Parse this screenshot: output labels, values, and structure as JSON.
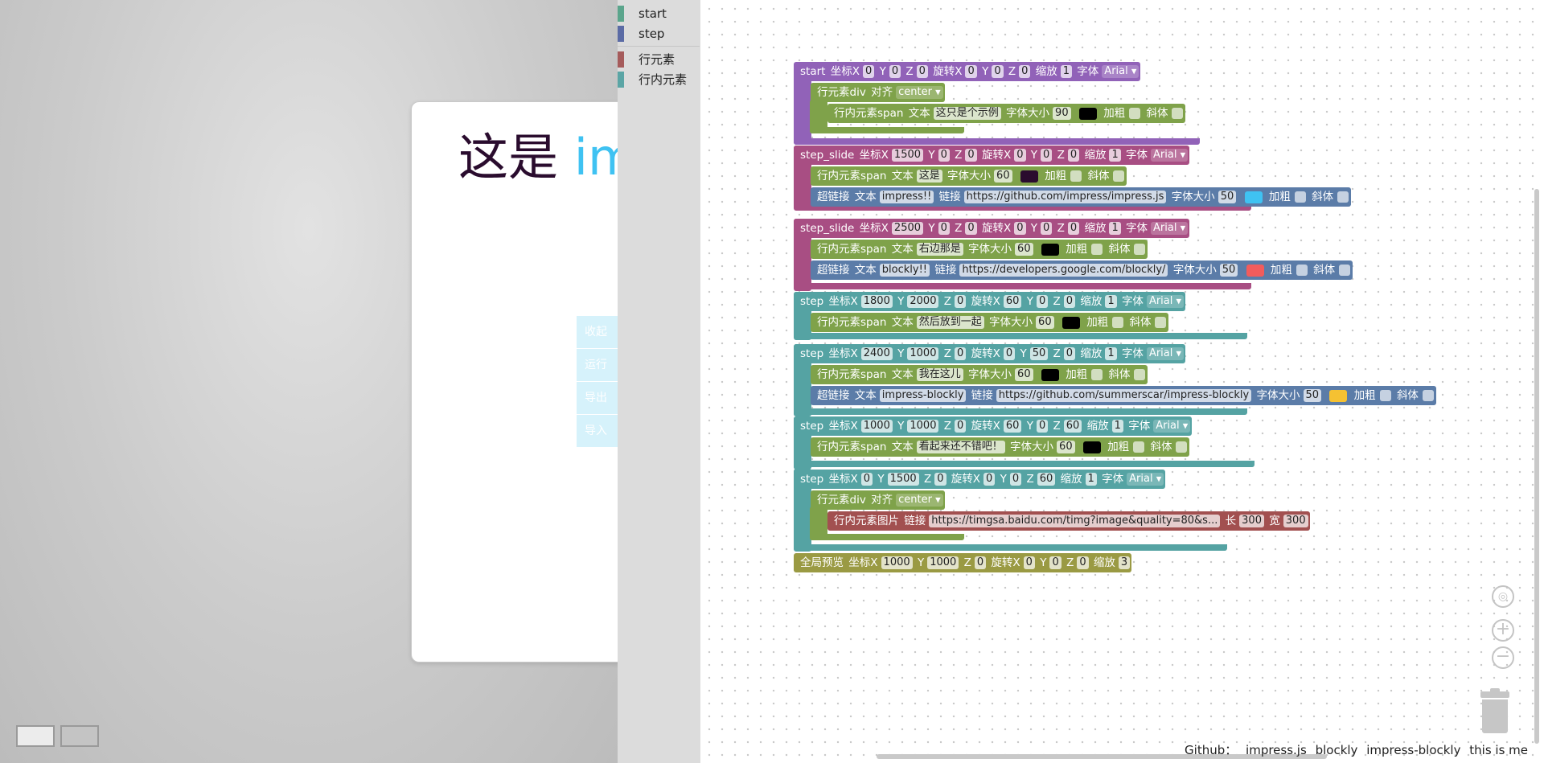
{
  "slide": {
    "text_dark": "这是",
    "text_blue": "imp"
  },
  "menu": [
    "收起",
    "运行",
    "导出",
    "导入"
  ],
  "toolbox": {
    "categories": [
      {
        "label": "start",
        "color": "#5ba58c"
      },
      {
        "label": "step",
        "color": "#5b6ba5"
      },
      {
        "label": "行元素",
        "color": "#a55b5b"
      },
      {
        "label": "行内元素",
        "color": "#5ba5a5"
      }
    ]
  },
  "blocks": {
    "b1": {
      "label": "start",
      "kx": "坐标X",
      "x": "0",
      "ky": "Y",
      "y": "0",
      "kz": "Z",
      "z": "0",
      "krx": "旋转X",
      "rx": "0",
      "kry": "Y",
      "ry": "0",
      "krz": "Z",
      "rz": "0",
      "ks": "缩放",
      "s": "1",
      "kf": "字体",
      "font": "Arial"
    },
    "b1d": {
      "label": "行元素div",
      "ka": "对齐",
      "align": "center"
    },
    "b1s": {
      "label": "行内元素span",
      "kt": "文本",
      "text": "这只是个示例",
      "kfs": "字体大小",
      "fs": "90",
      "kb": "加粗",
      "ki": "斜体",
      "color": "#000000"
    },
    "b2": {
      "label": "step_slide",
      "kx": "坐标X",
      "x": "1500",
      "ky": "Y",
      "y": "0",
      "kz": "Z",
      "z": "0",
      "krx": "旋转X",
      "rx": "0",
      "kry": "Y",
      "ry": "0",
      "krz": "Z",
      "rz": "0",
      "ks": "缩放",
      "s": "1",
      "kf": "字体",
      "font": "Arial"
    },
    "b2s": {
      "label": "行内元素span",
      "kt": "文本",
      "text": "这是",
      "kfs": "字体大小",
      "fs": "60",
      "kb": "加粗",
      "ki": "斜体",
      "color": "#2a0c2e"
    },
    "b2l": {
      "label": "超链接",
      "kt": "文本",
      "text": "impress!!",
      "kl": "链接",
      "link": "https://github.com/impress/impress.js",
      "kfs": "字体大小",
      "fs": "50",
      "kb": "加粗",
      "ki": "斜体",
      "color": "#3fc2f2"
    },
    "b3": {
      "label": "step_slide",
      "kx": "坐标X",
      "x": "2500",
      "ky": "Y",
      "y": "0",
      "kz": "Z",
      "z": "0",
      "krx": "旋转X",
      "rx": "0",
      "kry": "Y",
      "ry": "0",
      "krz": "Z",
      "rz": "0",
      "ks": "缩放",
      "s": "1",
      "kf": "字体",
      "font": "Arial"
    },
    "b3s": {
      "label": "行内元素span",
      "kt": "文本",
      "text": "右边那是",
      "kfs": "字体大小",
      "fs": "60",
      "kb": "加粗",
      "ki": "斜体",
      "color": "#000000"
    },
    "b3l": {
      "label": "超链接",
      "kt": "文本",
      "text": "blockly!!",
      "kl": "链接",
      "link": "https://developers.google.com/blockly/",
      "kfs": "字体大小",
      "fs": "50",
      "kb": "加粗",
      "ki": "斜体",
      "color": "#f25c5c"
    },
    "b4": {
      "label": "step",
      "kx": "坐标X",
      "x": "1800",
      "ky": "Y",
      "y": "2000",
      "kz": "Z",
      "z": "0",
      "krx": "旋转X",
      "rx": "60",
      "kry": "Y",
      "ry": "0",
      "krz": "Z",
      "rz": "0",
      "ks": "缩放",
      "s": "1",
      "kf": "字体",
      "font": "Arial"
    },
    "b4s": {
      "label": "行内元素span",
      "kt": "文本",
      "text": "然后放到一起",
      "kfs": "字体大小",
      "fs": "60",
      "kb": "加粗",
      "ki": "斜体",
      "color": "#000000"
    },
    "b5": {
      "label": "step",
      "kx": "坐标X",
      "x": "2400",
      "ky": "Y",
      "y": "1000",
      "kz": "Z",
      "z": "0",
      "krx": "旋转X",
      "rx": "0",
      "kry": "Y",
      "ry": "50",
      "krz": "Z",
      "rz": "0",
      "ks": "缩放",
      "s": "1",
      "kf": "字体",
      "font": "Arial"
    },
    "b5s": {
      "label": "行内元素span",
      "kt": "文本",
      "text": "我在这儿",
      "kfs": "字体大小",
      "fs": "60",
      "kb": "加粗",
      "ki": "斜体",
      "color": "#000000"
    },
    "b5l": {
      "label": "超链接",
      "kt": "文本",
      "text": "impress-blockly",
      "kl": "链接",
      "link": "https://github.com/summerscar/impress-blockly",
      "kfs": "字体大小",
      "fs": "50",
      "kb": "加粗",
      "ki": "斜体",
      "color": "#f5c132"
    },
    "b6": {
      "label": "step",
      "kx": "坐标X",
      "x": "1000",
      "ky": "Y",
      "y": "1000",
      "kz": "Z",
      "z": "0",
      "krx": "旋转X",
      "rx": "60",
      "kry": "Y",
      "ry": "0",
      "krz": "Z",
      "rz": "60",
      "ks": "缩放",
      "s": "1",
      "kf": "字体",
      "font": "Arial"
    },
    "b6s": {
      "label": "行内元素span",
      "kt": "文本",
      "text": "看起来还不错吧！",
      "kfs": "字体大小",
      "fs": "60",
      "kb": "加粗",
      "ki": "斜体",
      "color": "#000000"
    },
    "b7": {
      "label": "step",
      "kx": "坐标X",
      "x": "0",
      "ky": "Y",
      "y": "1500",
      "kz": "Z",
      "z": "0",
      "krx": "旋转X",
      "rx": "0",
      "kry": "Y",
      "ry": "0",
      "krz": "Z",
      "rz": "60",
      "ks": "缩放",
      "s": "1",
      "kf": "字体",
      "font": "Arial"
    },
    "b7d": {
      "label": "行元素div",
      "ka": "对齐",
      "align": "center"
    },
    "b7i": {
      "label": "行内元素图片",
      "kl": "链接",
      "link": "https://timgsa.baidu.com/timg?image&quality=80&s...",
      "kh": "长",
      "h": "300",
      "kw": "宽",
      "w": "300"
    },
    "b8": {
      "label": "全局预览",
      "kx": "坐标X",
      "x": "1000",
      "ky": "Y",
      "y": "1000",
      "kz": "Z",
      "z": "0",
      "krx": "旋转X",
      "rx": "0",
      "kry": "Y",
      "ry": "0",
      "krz": "Z",
      "rz": "0",
      "ks": "缩放",
      "s": "3"
    }
  },
  "footer": {
    "prefix": "Github：",
    "link1": "impress.js",
    "link2": "blockly",
    "link3": "impress-blockly",
    "link4": "this is me"
  },
  "icons": {
    "recenter": "target-icon",
    "zoom_in": "plus-icon",
    "zoom_out": "minus-icon",
    "trash": "trash-icon",
    "dropdown": "chevron-down-icon"
  }
}
